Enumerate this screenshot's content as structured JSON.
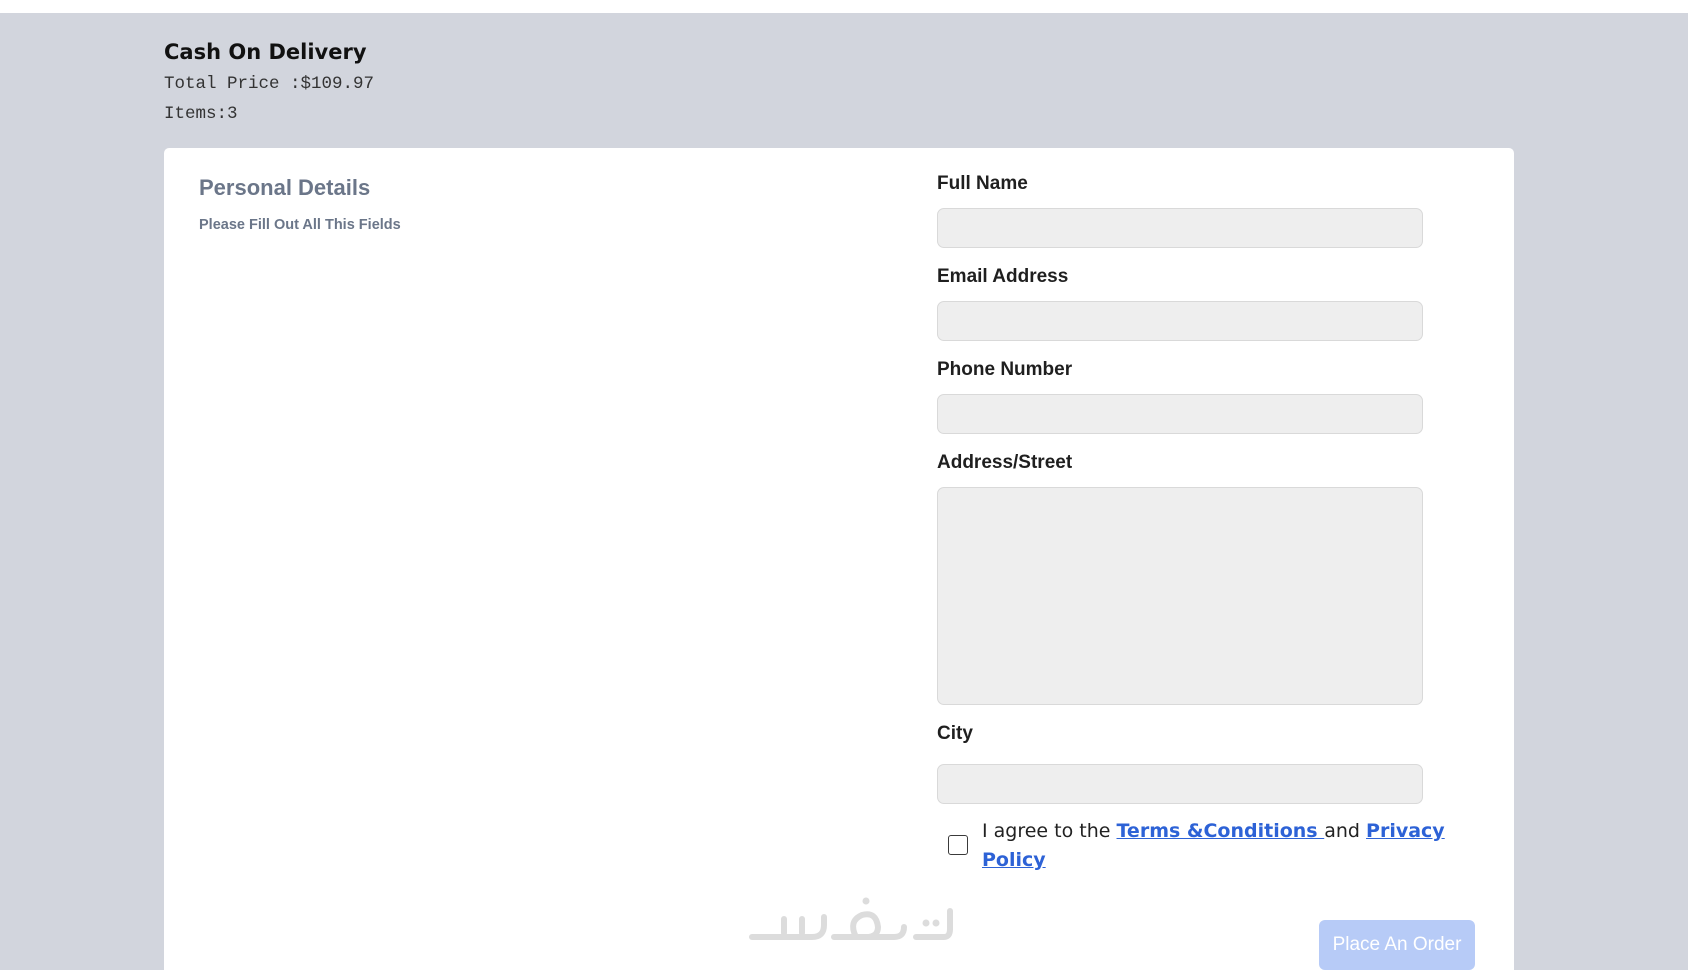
{
  "summary": {
    "title": "Cash On Delivery",
    "total_price": "Total Price :$109.97",
    "items": "Items:3"
  },
  "personal_details": {
    "title": "Personal Details",
    "subtitle": "Please Fill Out All This Fields"
  },
  "form": {
    "full_name": {
      "label": "Full Name",
      "value": ""
    },
    "email": {
      "label": "Email Address",
      "value": ""
    },
    "phone": {
      "label": "Phone Number",
      "value": ""
    },
    "address": {
      "label": "Address/Street",
      "value": ""
    },
    "city": {
      "label": "City",
      "value": ""
    }
  },
  "agreement": {
    "checked": false,
    "prefix": "I agree to the ",
    "terms_link": "Terms &Conditions ",
    "middle": "and ",
    "privacy_link": "Privacy Policy"
  },
  "order_button": {
    "label": "Place An Order",
    "color": "#b7cbf7"
  },
  "colors": {
    "page_background": "#d2d5dd",
    "card_background": "#ffffff",
    "input_background": "#eeeeee",
    "link": "#2d62d6",
    "muted_heading": "#6b7689"
  },
  "watermark": {
    "icon": "brand-logo-watermark-icon"
  }
}
